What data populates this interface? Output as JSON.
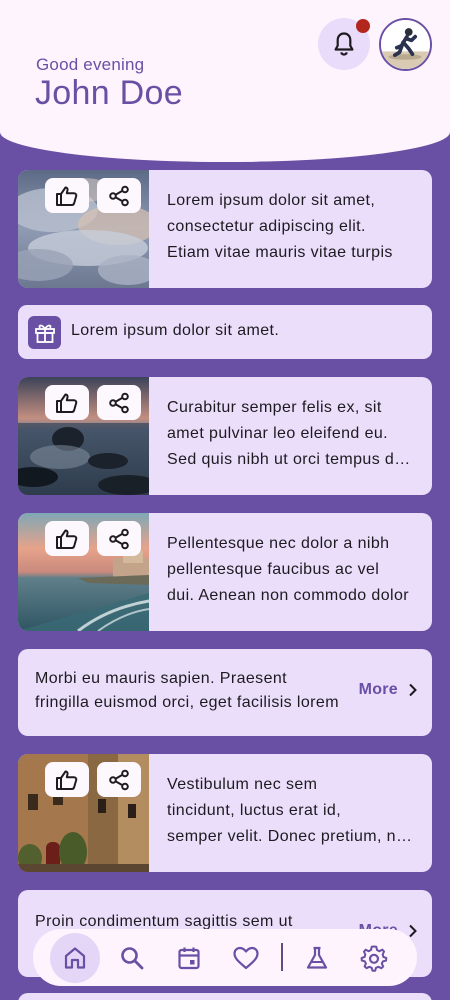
{
  "header": {
    "greeting": "Good evening",
    "username": "John Doe",
    "notification_icon": "bell-icon",
    "has_unread": true,
    "avatar_icon": "runner-avatar"
  },
  "feed": [
    {
      "type": "image-card",
      "image": "cloudy-sky-photo",
      "lines": [
        "Lorem ipsum dolor sit amet,",
        "consectetur adipiscing elit.",
        "Etiam vitae mauris vitae turpis"
      ]
    },
    {
      "type": "promo",
      "icon": "gift-icon",
      "text": "Lorem ipsum dolor sit amet."
    },
    {
      "type": "image-card",
      "image": "rocky-shore-photo",
      "lines": [
        "Curabitur semper felis ex, sit",
        "amet pulvinar leo eleifend eu.",
        "Sed quis nibh ut orci tempus dolor"
      ]
    },
    {
      "type": "image-card",
      "image": "sunset-coast-photo",
      "lines": [
        "Pellentesque nec dolor a nibh",
        "pellentesque faucibus ac vel",
        "dui. Aenean non commodo dolor"
      ]
    },
    {
      "type": "more-card",
      "lines": [
        "Morbi eu mauris sapien. Praesent",
        "fringilla euismod orci, eget facilisis lorem"
      ],
      "more_label": "More"
    },
    {
      "type": "image-card",
      "image": "old-town-street-photo",
      "lines": [
        "Vestibulum nec sem",
        "tincidunt, luctus erat id,",
        "semper velit. Donec pretium, nunc"
      ]
    },
    {
      "type": "more-card",
      "lines": [
        "Proin condimentum sagittis sem ut"
      ],
      "more_label": "More"
    }
  ],
  "nav": {
    "items": [
      "home-icon",
      "search-icon",
      "calendar-icon",
      "heart-icon",
      "flask-icon",
      "gear-icon"
    ],
    "active": "home-icon"
  },
  "colors": {
    "primary": "#6a50a4",
    "surface": "#fdf4fd",
    "card": "#ebdefb",
    "badge": "#b3261e"
  }
}
